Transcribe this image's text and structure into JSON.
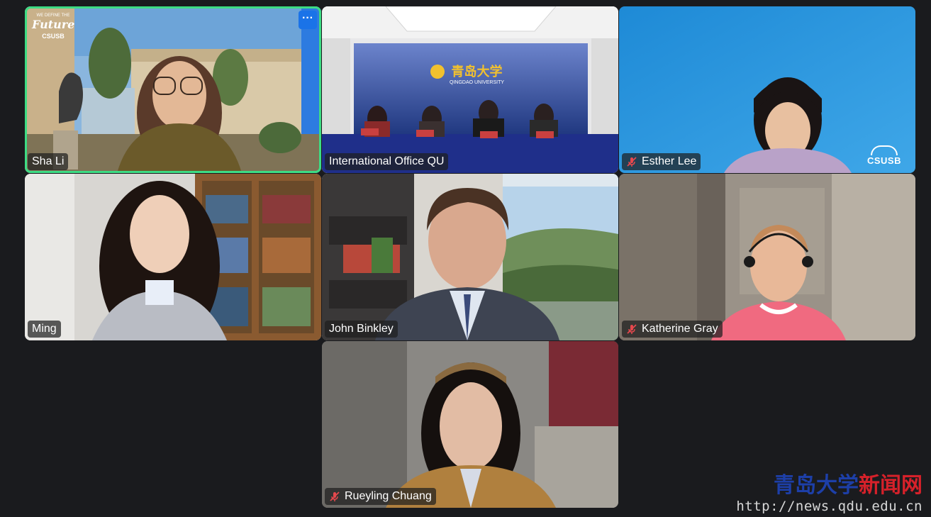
{
  "participants": [
    {
      "name": "Sha Li",
      "muted": false,
      "active_speaker": true
    },
    {
      "name": "International Office QU",
      "muted": false,
      "active_speaker": false
    },
    {
      "name": "Esther Lee",
      "muted": true,
      "active_speaker": false
    },
    {
      "name": "Ming",
      "muted": false,
      "active_speaker": false
    },
    {
      "name": "John Binkley",
      "muted": false,
      "active_speaker": false
    },
    {
      "name": "Katherine Gray",
      "muted": true,
      "active_speaker": false
    },
    {
      "name": "Rueyling Chuang",
      "muted": true,
      "active_speaker": false
    }
  ],
  "tile_menu": {
    "label": "···"
  },
  "backdrops": {
    "sha_li_banner": "Future",
    "sha_li_banner_top": "WE DEFINE THE",
    "sha_li_logo": "CSUSB",
    "qu_banner": "青岛大学",
    "qu_banner_sub": "QINGDAO UNIVERSITY",
    "esther_logo": "CSUSB"
  },
  "watermark": {
    "title_part1": "青岛大学",
    "title_part2": "新闻网",
    "url": "http://news.qdu.edu.cn"
  },
  "colors": {
    "background": "#1a1b1e",
    "active_border": "#3ddc84",
    "mute_red": "#e5484d",
    "more_button": "#1a73e8"
  },
  "icons": [
    "more-options-icon",
    "microphone-muted-icon"
  ]
}
